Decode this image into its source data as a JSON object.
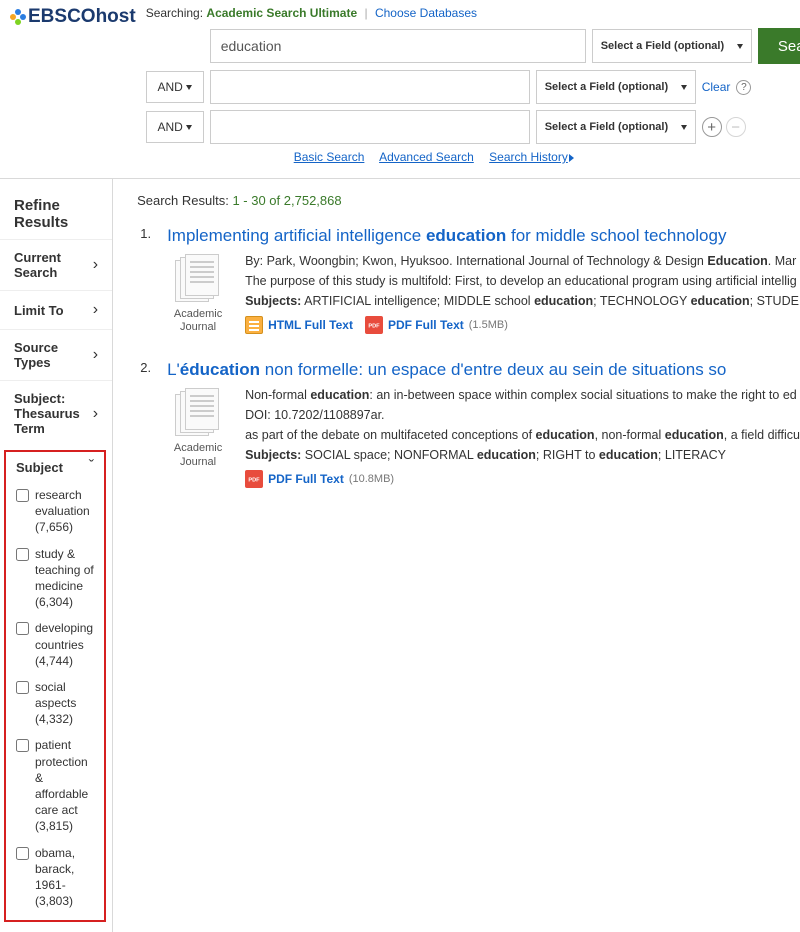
{
  "logo": "EBSCOhost",
  "header": {
    "searching_label": "Searching:",
    "database": "Academic Search Ultimate",
    "choose_db": "Choose Databases"
  },
  "search": {
    "rows": [
      {
        "bool": "",
        "value": "education",
        "field": "Select a Field (optional)"
      },
      {
        "bool": "AND",
        "value": "",
        "field": "Select a Field (optional)"
      },
      {
        "bool": "AND",
        "value": "",
        "field": "Select a Field (optional)"
      }
    ],
    "search_btn": "Search",
    "clear": "Clear"
  },
  "links": {
    "basic": "Basic Search",
    "advanced": "Advanced Search",
    "history": "Search History"
  },
  "sidebar": {
    "refine": "Refine Results",
    "facets": [
      {
        "label": "Current Search"
      },
      {
        "label": "Limit To"
      },
      {
        "label": "Source Types"
      },
      {
        "label": "Subject: Thesaurus Term"
      }
    ],
    "subject_label": "Subject",
    "subjects": [
      "research evaluation (7,656)",
      "study & teaching of medicine (6,304)",
      "developing countries (4,744)",
      "social aspects (4,332)",
      "patient protection & affordable care act (3,815)",
      "obama, barack, 1961- (3,803)"
    ]
  },
  "results": {
    "count_prefix": "Search Results:",
    "count_range": "1 - 30 of 2,752,868",
    "items": [
      {
        "num": "1.",
        "title_pre": "Implementing artificial intelligence ",
        "title_em": "education",
        "title_post": " for middle school technology ",
        "by": "By: Park, Woongbin; Kwon, Hyuksoo. International Journal of Technology & Design ",
        "by_em": "Education",
        "by2": ". Mar",
        "abstract": "The purpose of this study is multifold: First, to develop an educational program using artificial intellig",
        "subjects_label": "Subjects:",
        "subjects_pre": " ARTIFICIAL intelligence; MIDDLE school ",
        "subjects_em1": "education",
        "subjects_mid": "; TECHNOLOGY ",
        "subjects_em2": "education",
        "subjects_post": "; STUDE",
        "html_ft": "HTML Full Text",
        "pdf_ft": "PDF Full Text",
        "pdf_size": "(1.5MB)",
        "src": "Academic Journal"
      },
      {
        "num": "2.",
        "title_pre": "L'",
        "title_em": "éducation",
        "title_post": " non formelle: un espace d'entre deux au sein de situations so",
        "by": "Non-formal ",
        "by_em": "education",
        "by2": ": an in-between space within complex social situations to make the right to ed",
        "doi": "DOI: 10.7202/1108897ar.",
        "abstract_pre": "as part of the debate on multifaceted conceptions of ",
        "abstract_em1": "education",
        "abstract_mid": ", non-formal ",
        "abstract_em2": "education",
        "abstract_post": ", a field difficu",
        "subjects_label": "Subjects:",
        "subjects_pre": " SOCIAL space; NONFORMAL ",
        "subjects_em1": "education",
        "subjects_mid": "; RIGHT to ",
        "subjects_em2": "education",
        "subjects_post": "; LITERACY",
        "pdf_ft": "PDF Full Text",
        "pdf_size": "(10.8MB)",
        "src": "Academic Journal"
      }
    ]
  }
}
